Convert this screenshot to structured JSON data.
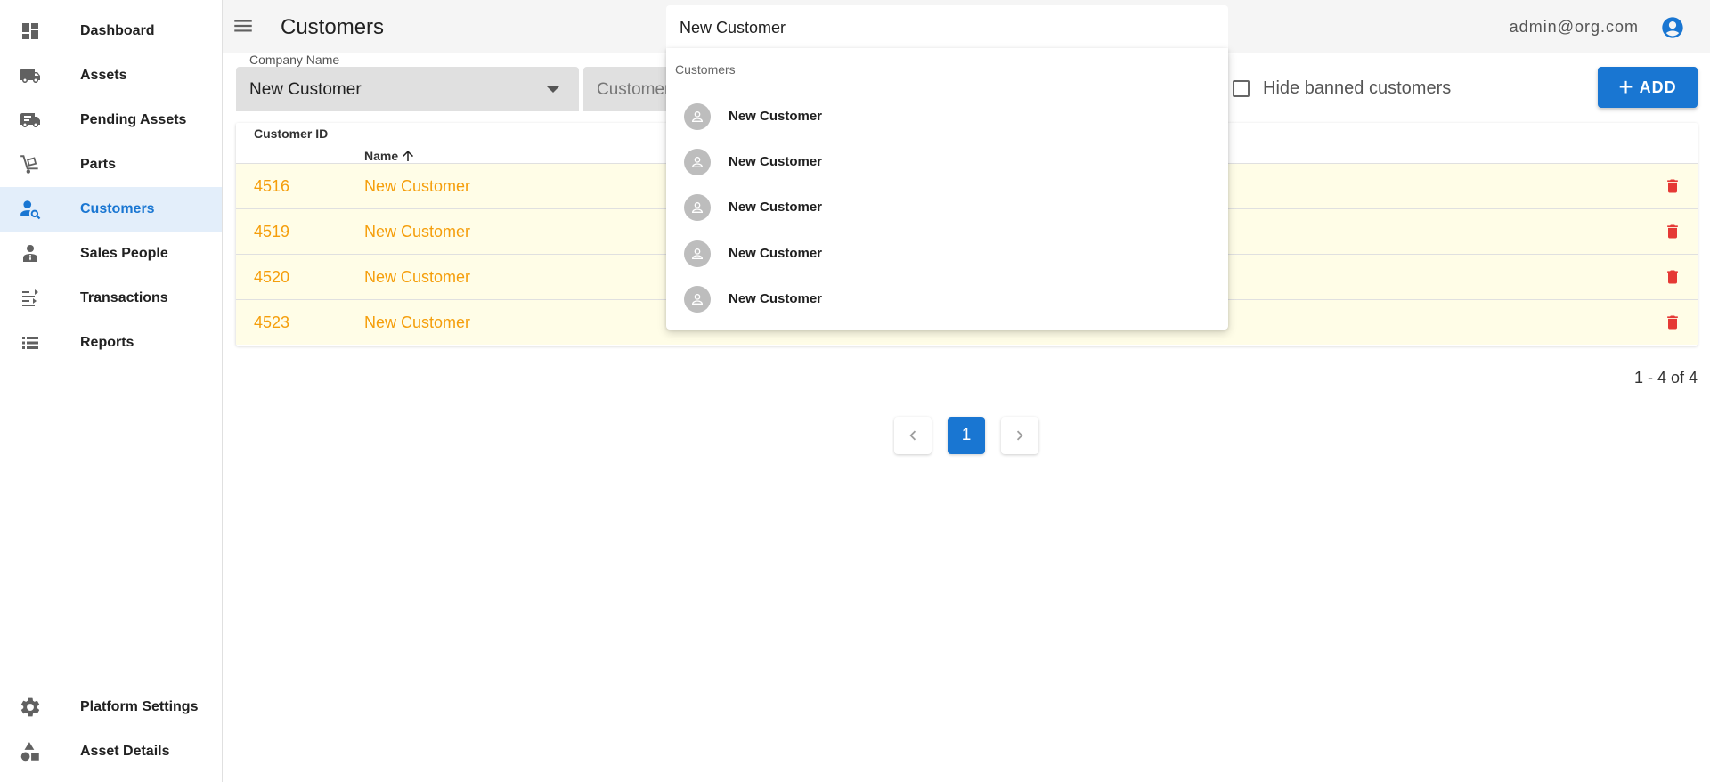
{
  "sidebar": {
    "items": [
      {
        "label": "Dashboard",
        "icon": "dashboard-icon"
      },
      {
        "label": "Assets",
        "icon": "truck-icon"
      },
      {
        "label": "Pending Assets",
        "icon": "truck-pending-icon"
      },
      {
        "label": "Parts",
        "icon": "dolly-icon"
      },
      {
        "label": "Customers",
        "icon": "account-search-icon",
        "active": true
      },
      {
        "label": "Sales People",
        "icon": "account-tie-icon"
      },
      {
        "label": "Transactions",
        "icon": "transactions-icon"
      },
      {
        "label": "Reports",
        "icon": "list-icon"
      }
    ],
    "bottom_items": [
      {
        "label": "Platform Settings",
        "icon": "gear-icon"
      },
      {
        "label": "Asset Details",
        "icon": "shapes-icon"
      }
    ]
  },
  "header": {
    "title": "Customers",
    "user_email": "admin@org.com"
  },
  "search": {
    "value": "New Customer",
    "dropdown_header": "Customers",
    "results": [
      "New Customer",
      "New Customer",
      "New Customer",
      "New Customer",
      "New Customer"
    ]
  },
  "filters": {
    "company_name_label": "Company Name",
    "company_name_value": "New Customer",
    "customer_field_placeholder": "Customer",
    "hide_banned_label": "Hide banned customers"
  },
  "add_button": {
    "label": "ADD"
  },
  "table": {
    "columns": [
      "Customer ID",
      "Name"
    ],
    "rows": [
      {
        "id": "4516",
        "name": "New Customer"
      },
      {
        "id": "4519",
        "name": "New Customer"
      },
      {
        "id": "4520",
        "name": "New Customer"
      },
      {
        "id": "4523",
        "name": "New Customer"
      }
    ]
  },
  "pagination": {
    "range_text": "1 - 4 of 4",
    "current_page": "1"
  },
  "colors": {
    "primary": "#1976d2",
    "row_text": "#f59e0b",
    "row_bg": "#fffde7",
    "delete": "#e53935"
  }
}
